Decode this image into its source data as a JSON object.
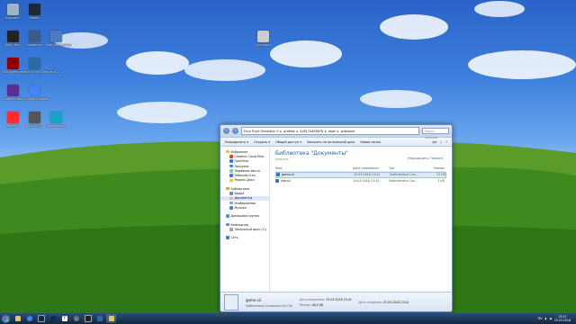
{
  "desktop": {
    "icons": [
      {
        "label": "Корзина",
        "color": "#9fb3c6"
      },
      {
        "label": "Steam",
        "color": "#1b2838"
      },
      {
        "label": "Unity Hub",
        "color": "#222222"
      },
      {
        "label": "Сохранить",
        "color": "#3b5a8a"
      },
      {
        "label": "Мой компьютер",
        "color": "#4a7bbd"
      },
      {
        "label": "MSI Afterburner",
        "color": "#8b0000"
      },
      {
        "label": "Euro Truck Simulator 2",
        "color": "#2d6aa3"
      },
      {
        "label": "Visual Studio",
        "color": "#5c2d91"
      },
      {
        "label": "Google Chrome",
        "color": "#4285f4"
      },
      {
        "label": "Яндекс",
        "color": "#ff2d2d"
      },
      {
        "label": "Unity 2017",
        "color": "#555555"
      },
      {
        "label": "Malwarebytes",
        "color": "#1aa3c7"
      },
      {
        "label": "Скриншот",
        "color": "#cccccc"
      }
    ]
  },
  "window": {
    "address": [
      "Euro Truck Simulator 2",
      "profiles",
      "42617A4F6678",
      "save",
      "autosave"
    ],
    "search_placeholder": "Поиск: autosave",
    "toolbar": {
      "organize": "Упорядочить ▾",
      "open": "Открыть ▾",
      "share": "Общий доступ ▾",
      "burn": "Записать на оптический диск",
      "new_folder": "Новая папка"
    },
    "nav": {
      "favorites": "Избранное",
      "favorites_items": [
        "Creative Cloud Files",
        "OneDrive",
        "Загрузки",
        "Недавние места",
        "Рабочий стол",
        "Яндекс.Диск"
      ],
      "libraries": "Библиотеки",
      "libraries_items": [
        "Видео",
        "Документы",
        "Изображения",
        "Музыка"
      ],
      "homegroup": "Домашняя группа",
      "computer": "Компьютер",
      "computer_items": [
        "Локальный диск (C:)"
      ],
      "network": "Сеть"
    },
    "library_title": "Библиотека \"Документы\"",
    "library_subtitle": "autosave",
    "arrange_label": "Упорядочить:",
    "arrange_value": "Папка ▾",
    "columns": [
      "Имя",
      "Дата изменения",
      "Тип",
      "Размер"
    ],
    "files": [
      {
        "name": "game.sii",
        "date": "25.03.2018 13:42",
        "type": "SoftInterface Con...",
        "size": "47 КБ"
      },
      {
        "name": "info.sii",
        "date": "25.03.2018 13:42",
        "type": "SoftInterface Con...",
        "size": "1 КБ"
      }
    ],
    "details": {
      "name": "game.sii",
      "type": "SoftInterface Conversion Ink File",
      "modified_label": "Дата изменения:",
      "modified": "25.03.2018 13:42",
      "size_label": "Размер:",
      "size": "46,5 КБ",
      "created_label": "Дата создания:",
      "created": "25.03.2018 13:42"
    }
  },
  "taskbar": {
    "time": "13:47",
    "date": "25.03.2018",
    "lang": "RU",
    "apps": [
      "explorer",
      "chrome",
      "steam",
      "photoshop",
      "yandex",
      "media",
      "unity",
      "ets2",
      "explorer-window"
    ]
  }
}
